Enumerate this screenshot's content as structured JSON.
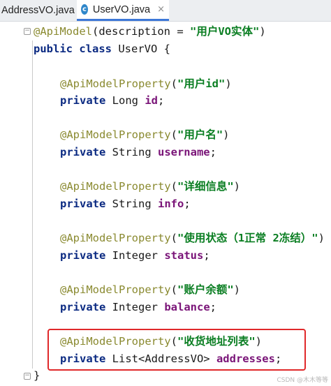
{
  "tabs": [
    {
      "label": "AddressVO.java",
      "active": false
    },
    {
      "label": "UserVO.java",
      "active": true,
      "icon": "class-c-icon",
      "close": "×"
    }
  ],
  "code": {
    "class_annotation": {
      "at": "@ApiModel",
      "open": "(",
      "attr": "description = ",
      "value": "\"用户VO实体\"",
      "close": ")"
    },
    "class_decl": {
      "kw1": "public",
      "kw2": "class",
      "name": " UserVO {"
    },
    "fields": [
      {
        "annotation": "@ApiModelProperty",
        "desc": "\"用户id\"",
        "modifier": "private",
        "type": " Long ",
        "name": "id",
        "semi": ";"
      },
      {
        "annotation": "@ApiModelProperty",
        "desc": "\"用户名\"",
        "modifier": "private",
        "type": " String ",
        "name": "username",
        "semi": ";"
      },
      {
        "annotation": "@ApiModelProperty",
        "desc": "\"详细信息\"",
        "modifier": "private",
        "type": " String ",
        "name": "info",
        "semi": ";"
      },
      {
        "annotation": "@ApiModelProperty",
        "desc": "\"使用状态（1正常 2冻结）\"",
        "modifier": "private",
        "type": " Integer ",
        "name": "status",
        "semi": ";"
      },
      {
        "annotation": "@ApiModelProperty",
        "desc": "\"账户余额\"",
        "modifier": "private",
        "type": " Integer ",
        "name": "balance",
        "semi": ";"
      },
      {
        "annotation": "@ApiModelProperty",
        "desc": "\"收货地址列表\"",
        "modifier": "private",
        "type": " List<AddressVO> ",
        "name": "addresses",
        "semi": ";"
      }
    ],
    "closing_brace": "}",
    "paren_open": "(",
    "paren_close": ")"
  },
  "watermark": "CSDN @木木等等",
  "colors": {
    "highlight_box": "#e0282a",
    "active_tab_underline": "#3d78d8",
    "keyword": "#0b2a82",
    "string": "#0a7e22",
    "field": "#7a1478",
    "annotation": "#8a8a30"
  }
}
